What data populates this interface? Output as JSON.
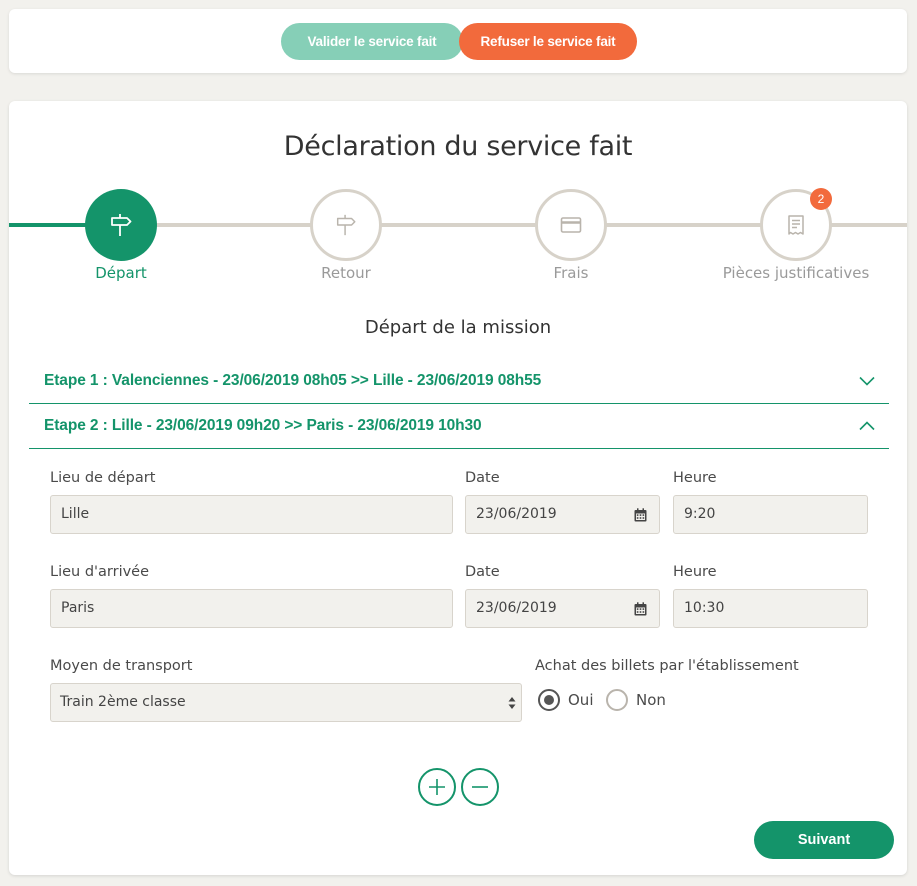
{
  "topbar": {
    "valider_label": "Valider le service fait",
    "refuser_label": "Refuser le service fait"
  },
  "card": {
    "title": "Déclaration du service fait",
    "subtitle": "Départ de la mission"
  },
  "steps": [
    {
      "label": "Départ",
      "icon": "signpost-icon",
      "active": true
    },
    {
      "label": "Retour",
      "icon": "signpost-icon",
      "active": false
    },
    {
      "label": "Frais",
      "icon": "credit-card-icon",
      "active": false
    },
    {
      "label": "Pièces justificatives",
      "icon": "receipt-icon",
      "active": false,
      "badge": "2"
    }
  ],
  "etapes": [
    {
      "label": "Etape 1 : Valenciennes - 23/06/2019 08h05 >> Lille - 23/06/2019 08h55",
      "expanded": false
    },
    {
      "label": "Etape 2 : Lille - 23/06/2019 09h20 >> Paris - 23/06/2019 10h30",
      "expanded": true
    }
  ],
  "form": {
    "depart": {
      "label": "Lieu de départ",
      "value": "Lille"
    },
    "depart_date": {
      "label": "Date",
      "value": "23/06/2019"
    },
    "depart_heure": {
      "label": "Heure",
      "value": "9:20"
    },
    "arrivee": {
      "label": "Lieu d'arrivée",
      "value": "Paris"
    },
    "arrivee_date": {
      "label": "Date",
      "value": "23/06/2019"
    },
    "arrivee_heure": {
      "label": "Heure",
      "value": "10:30"
    },
    "transport": {
      "label": "Moyen de transport",
      "value": "Train 2ème classe"
    },
    "achat": {
      "label": "Achat des billets par l'établissement",
      "oui": "Oui",
      "non": "Non",
      "selected": "Oui"
    }
  },
  "actions": {
    "suivant_label": "Suivant"
  },
  "colors": {
    "brand_green": "#14946a",
    "light_green": "#86cfb7",
    "orange": "#f26a3c"
  }
}
